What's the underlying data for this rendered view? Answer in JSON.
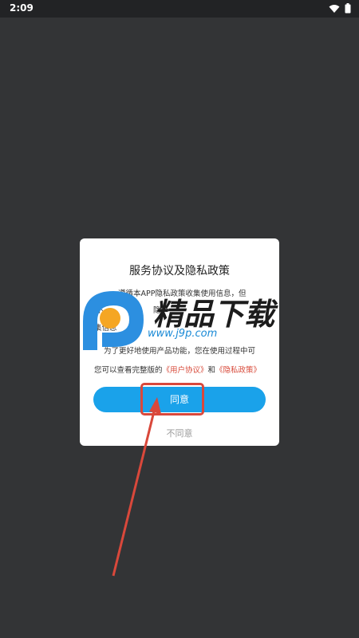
{
  "status_bar": {
    "time": "2:09",
    "icons": [
      "wifi-icon",
      "battery-icon"
    ]
  },
  "dialog": {
    "title": "服务协议及隐私政策",
    "body_line1": "遵循本APP隐私政策收集使用信息，但",
    "body_line2_a": "不",
    "body_line2_b": "隐",
    "body_line2_c": "方",
    "body_line3": "集信息",
    "body_line4": "为了更好地使用产品功能，您在使用过程中可",
    "body_line5_prefix": "您可以查看完整版的",
    "link_user_agreement": "《用户协议》",
    "conjunction": "和",
    "link_privacy_policy": "《隐私政策》",
    "agree_label": "同意",
    "disagree_label": "不同意"
  },
  "watermark": {
    "title": "精品下载",
    "url": "www.j9p.com"
  },
  "colors": {
    "primary": "#1aa2ea",
    "link": "#d84a3a",
    "annotation": "#d9483b",
    "background": "#333436"
  }
}
